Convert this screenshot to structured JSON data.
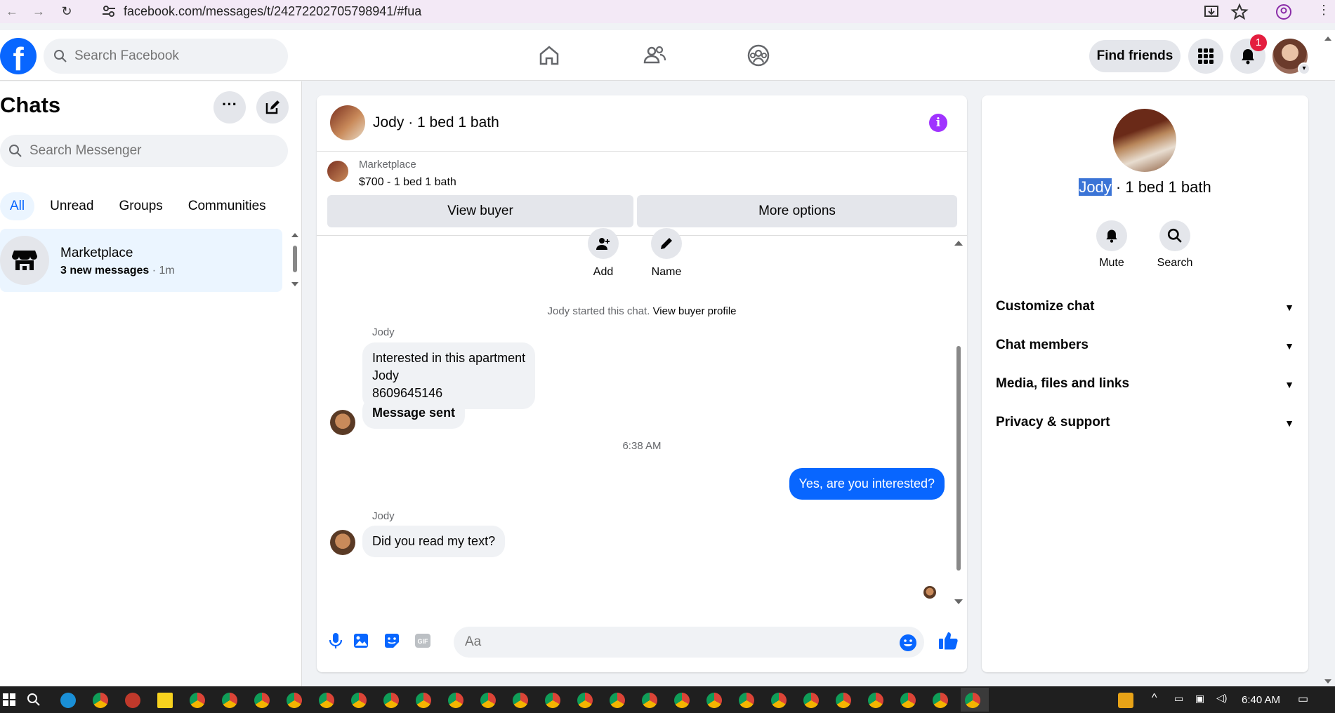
{
  "browser": {
    "url": "facebook.com/messages/t/24272202705798941/#fua"
  },
  "topbar": {
    "search_placeholder": "Search Facebook",
    "find_friends": "Find friends",
    "notification_count": "1",
    "logo": "f"
  },
  "left": {
    "title": "Chats",
    "search_placeholder": "Search Messenger",
    "filters": [
      "All",
      "Unread",
      "Groups",
      "Communities"
    ],
    "chat": {
      "name": "Marketplace",
      "unread": "3 new messages",
      "time": "1m"
    }
  },
  "conversation": {
    "title": "Jody · 1 bed 1 bath",
    "marketplace_label": "Marketplace",
    "listing": "$700 - 1 bed 1 bath",
    "view_buyer": "View buyer",
    "more_options": "More options",
    "add_label": "Add",
    "name_label": "Name",
    "started_text": "Jody started this chat.",
    "view_buyer_profile": "View buyer profile",
    "sender1": "Jody",
    "msg1_line1": "Interested in this apartment",
    "msg1_line2": "Jody",
    "msg1_line3": "8609645146",
    "msg2": "Message sent",
    "timestamp": "6:38 AM",
    "my_msg": "Yes, are you interested?",
    "sender2": "Jody",
    "msg3": "Did you read my text?",
    "composer_placeholder": "Aa"
  },
  "right": {
    "title_highlight": "Jody",
    "title_rest": " · 1 bed 1 bath",
    "mute": "Mute",
    "search": "Search",
    "sections": [
      "Customize chat",
      "Chat members",
      "Media, files and links",
      "Privacy & support"
    ]
  },
  "taskbar": {
    "time": "6:40 AM"
  },
  "colors": {
    "brand": "#0866ff",
    "info": "#a033ff",
    "badge": "#e41e3f"
  }
}
